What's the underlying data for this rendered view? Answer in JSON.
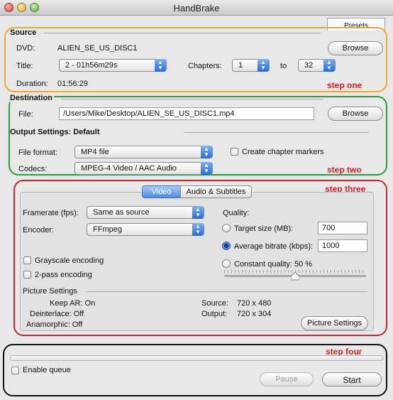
{
  "window": {
    "title": "HandBrake"
  },
  "presets_label": "Presets",
  "colors": {
    "step_one": "#f0a53a",
    "step_two": "#2f9a3a",
    "step_three": "#c0292f",
    "step_four": "#111111",
    "step_text": "#d0232b"
  },
  "source": {
    "heading": "Source",
    "dvd_label": "DVD:",
    "dvd_value": "ALIEN_SE_US_DISC1",
    "browse": "Browse",
    "title_label": "Title:",
    "title_value": "2 - 01h56m29s",
    "chapters_label": "Chapters:",
    "chapter_start": "1",
    "to_label": "to",
    "chapter_end": "32",
    "duration_label": "Duration:",
    "duration_value": "01:56:29",
    "step_label": "step one"
  },
  "destination": {
    "heading": "Destination",
    "file_label": "File:",
    "file_value": "/Users/Mike/Desktop/ALIEN_SE_US_DISC1.mp4",
    "browse": "Browse"
  },
  "output_settings": {
    "heading": "Output Settings: Default",
    "format_label": "File format:",
    "format_value": "MP4 file",
    "chapter_markers": "Create chapter markers",
    "codecs_label": "Codecs:",
    "codecs_value": "MPEG-4 Video / AAC Audio",
    "step_label": "step two"
  },
  "settings": {
    "step_label": "step three",
    "tab_video": "Video",
    "tab_audio": "Audio & Subtitles",
    "framerate_label": "Framerate (fps):",
    "framerate_value": "Same as source",
    "encoder_label": "Encoder:",
    "encoder_value": "FFmpeg",
    "grayscale": "Grayscale encoding",
    "two_pass": "2-pass encoding",
    "quality_label": "Quality:",
    "target_size_label": "Target size (MB):",
    "target_size_value": "700",
    "avg_bitrate_label": "Average bitrate (kbps):",
    "avg_bitrate_value": "1000",
    "const_quality_label": "Constant quality: 50 %",
    "quality_slider_level": 0.5,
    "picture_settings_heading": "Picture Settings",
    "keep_ar": "Keep AR: On",
    "deinterlace": "Deinterlace: Off",
    "anamorphic": "Anamorphic: Off",
    "source_label": "Source:",
    "source_res": "720 x 480",
    "output_label": "Output:",
    "output_res": "720 x 304",
    "picture_settings_btn": "Picture Settings"
  },
  "queue": {
    "step_label": "step four",
    "enable_queue": "Enable queue",
    "pause": "Pause",
    "start": "Start"
  }
}
